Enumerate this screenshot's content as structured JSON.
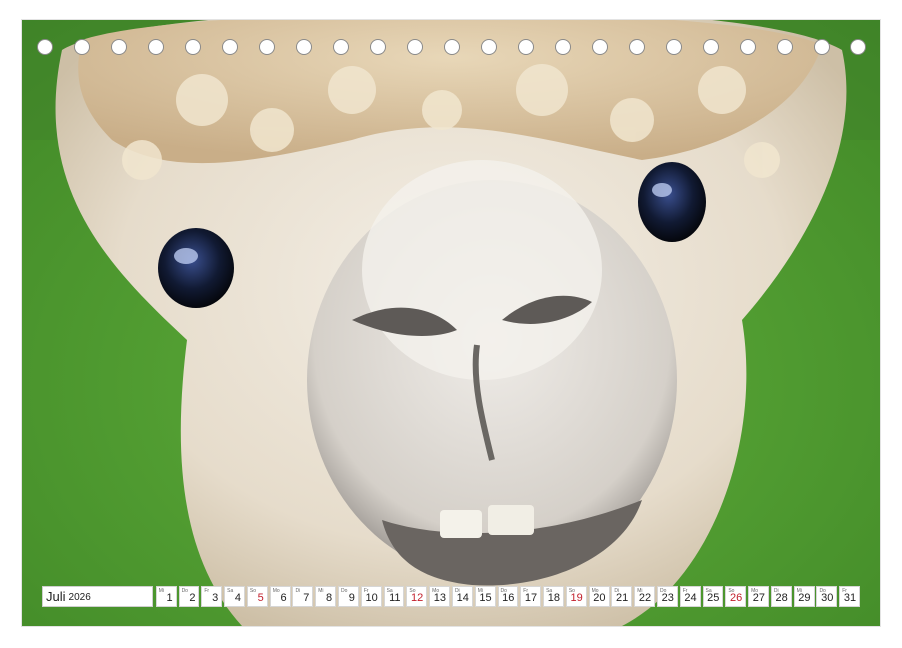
{
  "calendar": {
    "month": "Juli",
    "year": "2026",
    "days": [
      {
        "wd": "Mi",
        "num": "1"
      },
      {
        "wd": "Do",
        "num": "2"
      },
      {
        "wd": "Fr",
        "num": "3"
      },
      {
        "wd": "Sa",
        "num": "4"
      },
      {
        "wd": "So",
        "num": "5",
        "sun": true
      },
      {
        "wd": "Mo",
        "num": "6"
      },
      {
        "wd": "Di",
        "num": "7"
      },
      {
        "wd": "Mi",
        "num": "8"
      },
      {
        "wd": "Do",
        "num": "9"
      },
      {
        "wd": "Fr",
        "num": "10"
      },
      {
        "wd": "Sa",
        "num": "11"
      },
      {
        "wd": "So",
        "num": "12",
        "sun": true
      },
      {
        "wd": "Mo",
        "num": "13"
      },
      {
        "wd": "Di",
        "num": "14"
      },
      {
        "wd": "Mi",
        "num": "15"
      },
      {
        "wd": "Do",
        "num": "16"
      },
      {
        "wd": "Fr",
        "num": "17"
      },
      {
        "wd": "Sa",
        "num": "18"
      },
      {
        "wd": "So",
        "num": "19",
        "sun": true
      },
      {
        "wd": "Mo",
        "num": "20"
      },
      {
        "wd": "Di",
        "num": "21"
      },
      {
        "wd": "Mi",
        "num": "22"
      },
      {
        "wd": "Do",
        "num": "23"
      },
      {
        "wd": "Fr",
        "num": "24"
      },
      {
        "wd": "Sa",
        "num": "25"
      },
      {
        "wd": "So",
        "num": "26",
        "sun": true
      },
      {
        "wd": "Mo",
        "num": "27"
      },
      {
        "wd": "Di",
        "num": "28"
      },
      {
        "wd": "Mi",
        "num": "29"
      },
      {
        "wd": "Do",
        "num": "30"
      },
      {
        "wd": "Fr",
        "num": "31"
      }
    ]
  },
  "colors": {
    "grass": "#4f9a2f",
    "fleece": "#ece3d2",
    "sunday": "#c21e2b"
  }
}
